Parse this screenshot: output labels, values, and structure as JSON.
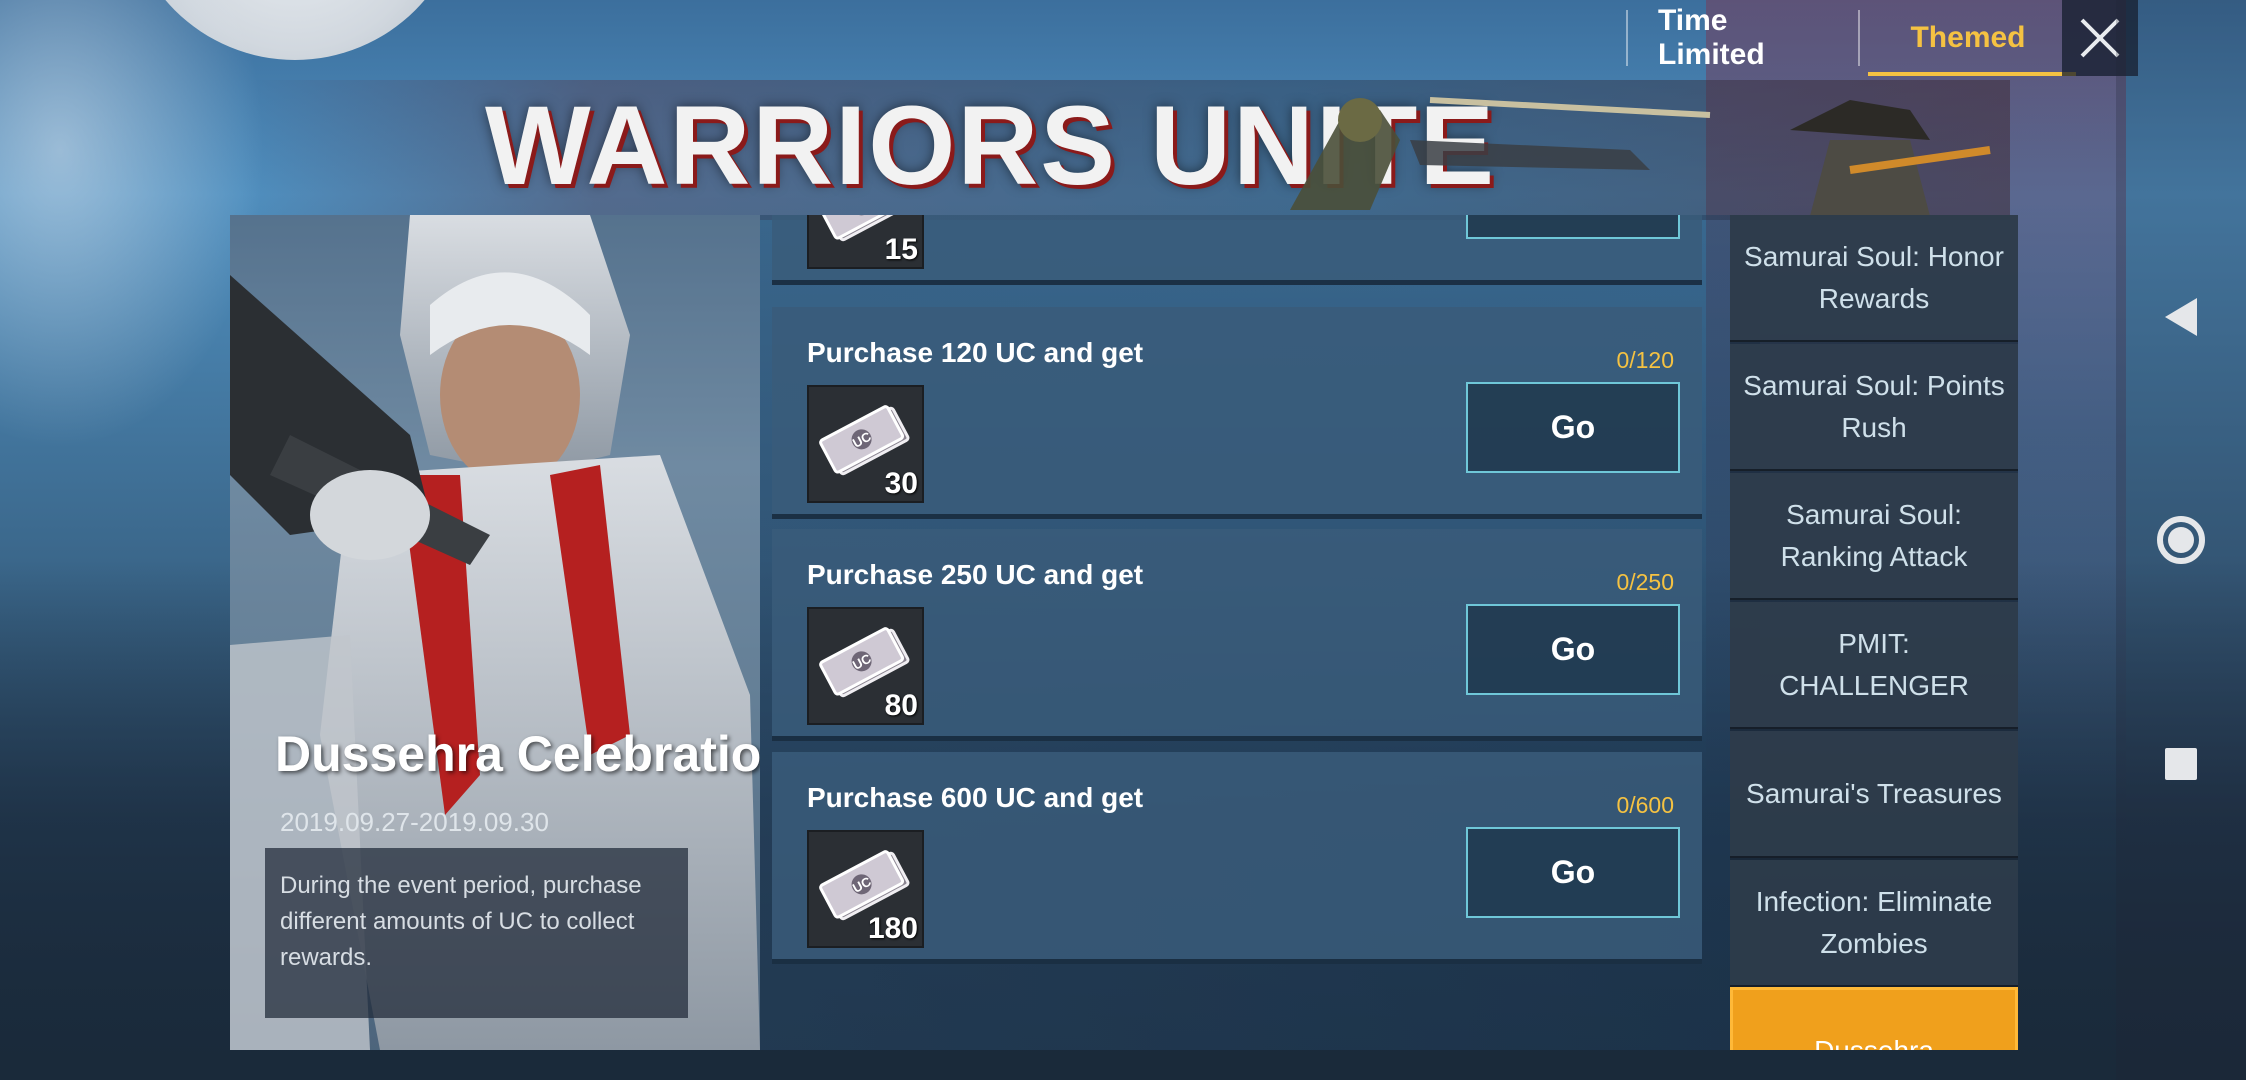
{
  "top_tabs": {
    "time_limited": "Time Limited",
    "themed": "Themed",
    "active": "Themed"
  },
  "banner": {
    "title": "WARRIORS UNITE"
  },
  "promo": {
    "title": "Dussehra Celebration",
    "date": "2019.09.27-2019.09.30",
    "description": "During the event period, purchase different amounts of UC to collect rewards."
  },
  "tasks": [
    {
      "label": "",
      "progress": "",
      "reward_count": "15",
      "button": ""
    },
    {
      "label": "Purchase 120 UC and get",
      "progress": "0/120",
      "reward_count": "30",
      "button": "Go"
    },
    {
      "label": "Purchase 250 UC and get",
      "progress": "0/250",
      "reward_count": "80",
      "button": "Go"
    },
    {
      "label": "Purchase 600 UC and get",
      "progress": "0/600",
      "reward_count": "180",
      "button": "Go"
    }
  ],
  "side_menu": [
    {
      "label": "Samurai Soul: Honor Rewards",
      "active": false
    },
    {
      "label": "Samurai Soul: Points Rush",
      "active": false
    },
    {
      "label": "Samurai Soul: Ranking Attack",
      "active": false
    },
    {
      "label": "PMIT: CHALLENGER",
      "active": false
    },
    {
      "label": "Samurai's Treasures",
      "active": false
    },
    {
      "label": "Infection: Eliminate Zombies",
      "active": false
    },
    {
      "label": "Dussehra Celebration",
      "active": true
    }
  ],
  "icons": {
    "close": "close-icon",
    "reward": "uc-voucher-icon",
    "nav_back": "back-triangle-icon",
    "nav_home": "home-circle-icon",
    "nav_recent": "recent-square-icon"
  },
  "colors": {
    "accent_gold": "#f5c242",
    "active_orange": "#f0a01c",
    "go_border": "#6fc7d8"
  }
}
